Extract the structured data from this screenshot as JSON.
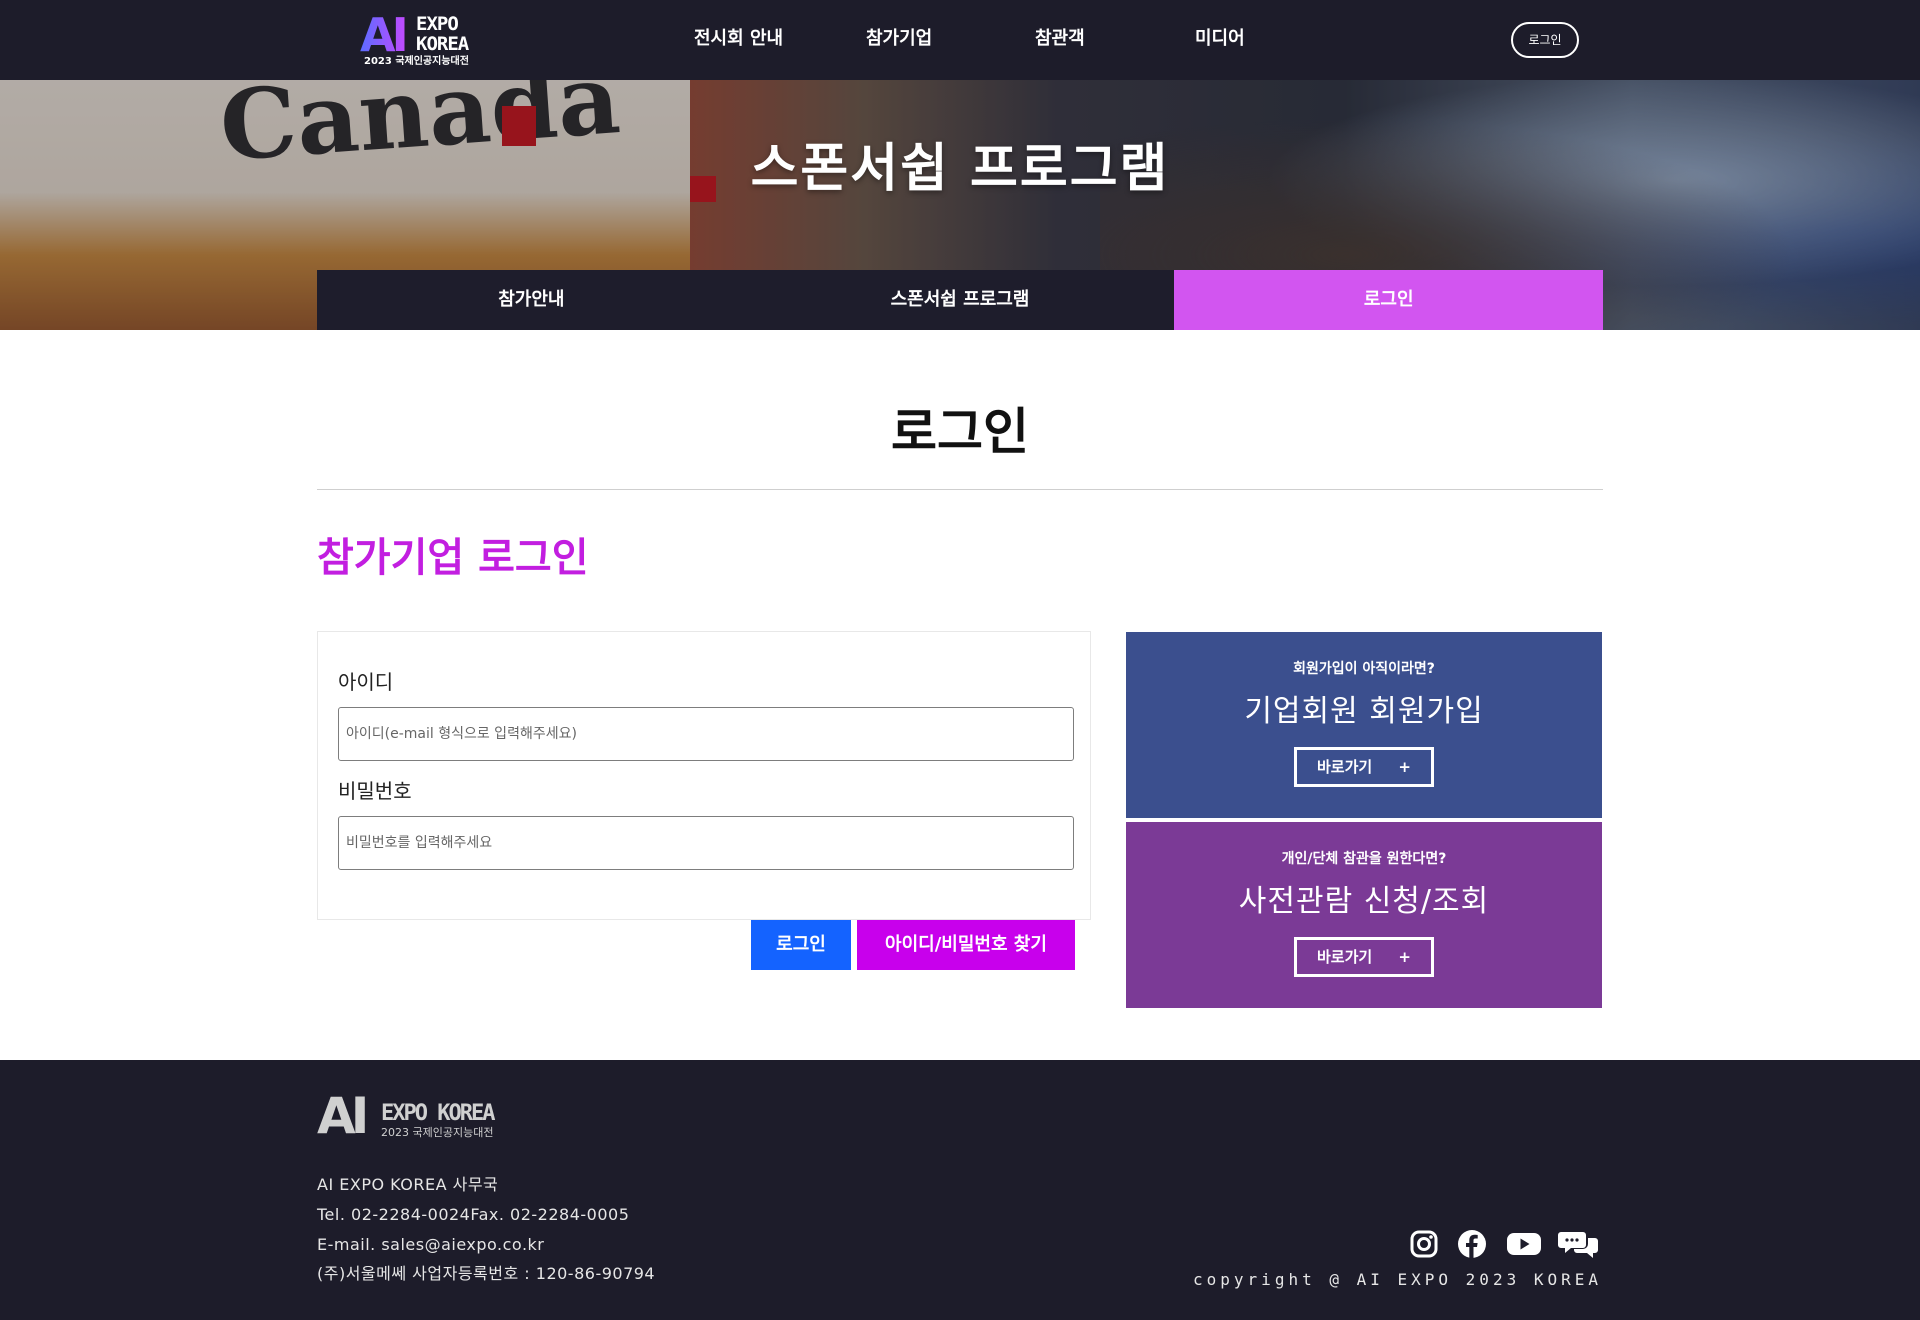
{
  "header": {
    "logo": {
      "mark": "AI",
      "name_line1": "EXPO",
      "name_line2": "KOREA",
      "sub": "2023 국제인공지능대전"
    },
    "nav": [
      "전시회 안내",
      "참가기업",
      "참관객",
      "미디어"
    ],
    "login_label": "로그인"
  },
  "hero": {
    "title": "스폰서쉽 프로그램",
    "tabs": [
      {
        "label": "참가안내",
        "active": false
      },
      {
        "label": "스폰서쉽 프로그램",
        "active": false
      },
      {
        "label": "로그인",
        "active": true
      }
    ]
  },
  "main": {
    "page_title": "로그인",
    "section_title": "참가기업 로그인",
    "form": {
      "id_label": "아이디",
      "id_placeholder": "아이디(e-mail 형식으로 입력해주세요)",
      "pw_label": "비밀번호",
      "pw_placeholder": "비밀번호를 입력해주세요",
      "login_button": "로그인",
      "find_button": "아이디/비밀번호 찾기"
    },
    "cards": [
      {
        "question": "회원가입이 아직이라면?",
        "title": "기업회원 회원가입",
        "button": "바로가기",
        "plus": "+",
        "color": "#3b4f8e"
      },
      {
        "question": "개인/단체 참관을 원한다면?",
        "title": "사전관람 신청/조회",
        "button": "바로가기",
        "plus": "+",
        "color": "#7b3a96"
      }
    ]
  },
  "footer": {
    "logo": {
      "mark": "AI",
      "name": "EXPO KOREA",
      "sub": "2023 국제인공지능대전"
    },
    "office": "AI EXPO KOREA 사무국",
    "tel_fax": "Tel. 02-2284-0024Fax. 02-2284-0005",
    "email": "E-mail. sales@aiexpo.co.kr",
    "company": "(주)서울메쎄 사업자등록번호 : 120-86-90794",
    "social": [
      "instagram-icon",
      "facebook-icon",
      "youtube-icon",
      "chat-icon"
    ],
    "copyright": "copyright @ AI EXPO 2023 KOREA"
  },
  "colors": {
    "nav_bg": "#1d1c2a",
    "accent_purple": "#c21ee0",
    "active_tab": "#d255f0",
    "login_blue": "#1463ff",
    "find_magenta": "#c800ec"
  }
}
